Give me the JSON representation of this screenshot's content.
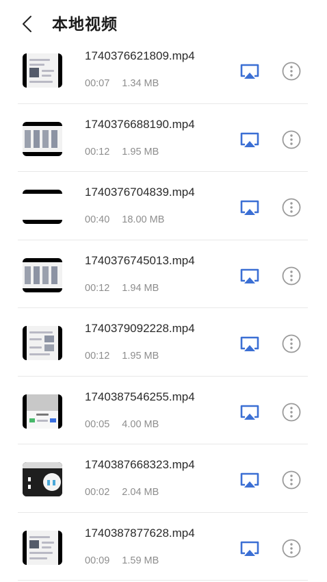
{
  "header": {
    "back_icon": "chevron-left-icon",
    "title": "本地视频"
  },
  "colors": {
    "accent": "#3b6fd4",
    "more_icon": "#9a9a9a",
    "meta_text": "#8d8d8d",
    "divider": "#e8e8e8"
  },
  "videos": [
    {
      "name": "1740376621809.mp4",
      "duration": "00:07",
      "size": "1.34 MB"
    },
    {
      "name": "1740376688190.mp4",
      "duration": "00:12",
      "size": "1.95 MB"
    },
    {
      "name": "1740376704839.mp4",
      "duration": "00:40",
      "size": "18.00 MB"
    },
    {
      "name": "1740376745013.mp4",
      "duration": "00:12",
      "size": "1.94 MB"
    },
    {
      "name": "1740379092228.mp4",
      "duration": "00:12",
      "size": "1.95 MB"
    },
    {
      "name": "1740387546255.mp4",
      "duration": "00:05",
      "size": "4.00 MB"
    },
    {
      "name": "1740387668323.mp4",
      "duration": "00:02",
      "size": "2.04 MB"
    },
    {
      "name": "1740387877628.mp4",
      "duration": "00:09",
      "size": "1.59 MB"
    }
  ],
  "row_icons": {
    "cast": "screen-cast-icon",
    "more": "more-options-icon"
  }
}
